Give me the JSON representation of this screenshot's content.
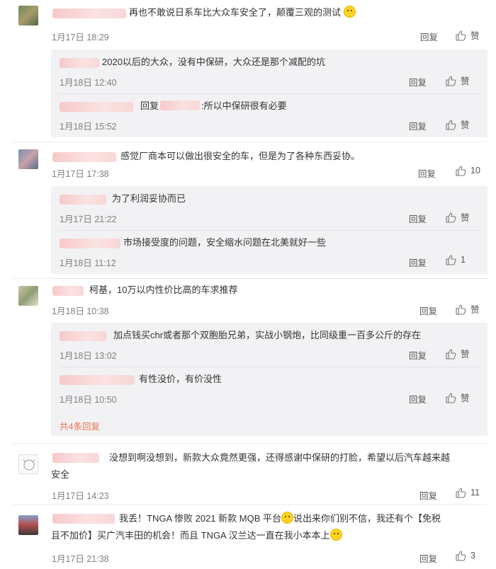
{
  "action_labels": {
    "reply": "回复",
    "like": "赞"
  },
  "comments": [
    {
      "text": "再也不敢说日系车比大众车安全了，颠覆三观的测试",
      "date": "1月17日 18:29",
      "likes": "赞",
      "replies": [
        {
          "text": "2020以后的大众，没有中保研，大众还是那个减配的坑",
          "date": "1月18日 12:40",
          "likes": "赞"
        },
        {
          "prefix": "回复",
          "text": ":所以中保研很有必要",
          "date": "1月18日 15:52",
          "likes": "赞"
        }
      ]
    },
    {
      "text": "感觉厂商本可以做出很安全的车，但是为了各种东西妥协。",
      "date": "1月17日 17:38",
      "likes": "10",
      "replies": [
        {
          "text": "为了利润妥协而已",
          "date": "1月17日 21:22",
          "likes": "赞"
        },
        {
          "text": "市场接受度的问题，安全缩水问题在北美就好一些",
          "date": "1月18日 11:12",
          "likes": "1"
        }
      ]
    },
    {
      "text": "柯基，10万以内性价比高的车求推荐",
      "date": "1月18日 10:38",
      "likes": "赞",
      "replies": [
        {
          "text": "加点钱买chr或者那个双胞胎兄弟，实战小钢炮，比同级重一百多公斤的存在",
          "date": "1月18日 13:02",
          "likes": "赞"
        },
        {
          "text": "有性没价，有价没性",
          "date": "1月18日 10:50",
          "likes": "赞"
        }
      ],
      "more_label": "共4条回复"
    },
    {
      "text_line1": "没想到啊没想到，新款大众竟然更强，还得感谢中保研的打脸，希望以后汽车越来越",
      "text_line2": "安全",
      "date": "1月17日 14:23",
      "likes": "11"
    },
    {
      "text_line1a": "我丢！TNGA 惨败 2021 新款 MQB 平台",
      "text_line1b": "说出来你们别不信，我还有个【免税",
      "text_line2a": "且不加价】买广汽丰田的机会！而且 TNGA 汉兰达一直在我小本本上",
      "date": "1月17日 21:38",
      "likes": "3"
    }
  ]
}
